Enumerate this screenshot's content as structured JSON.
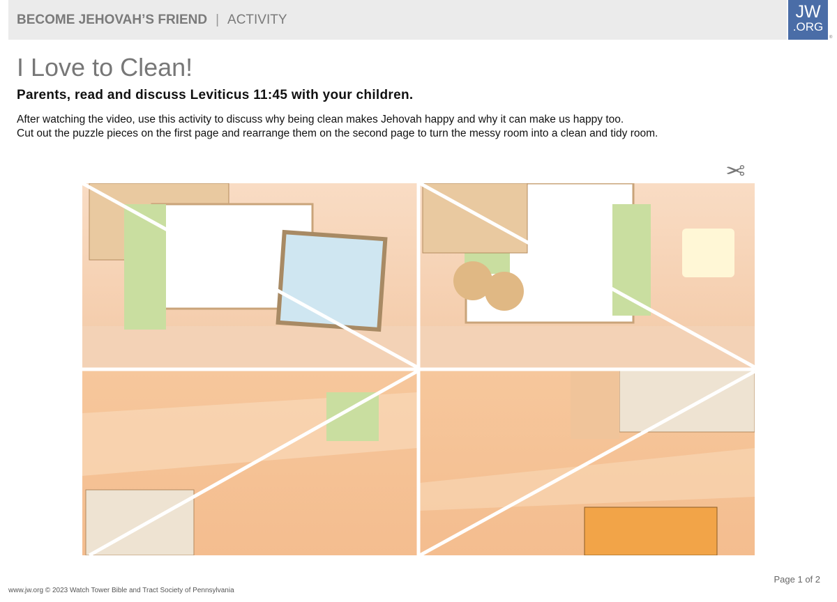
{
  "header": {
    "series": "BECOME JEHOVAH’S FRIEND",
    "section": "ACTIVITY",
    "separator": "|"
  },
  "logo": {
    "line1": "JW",
    "line2": ".ORG",
    "registered": "®"
  },
  "title": "I Love to Clean!",
  "subtitle": "Parents, read and discuss Leviticus 11:45 with your children.",
  "intro": [
    "After watching the video, use this activity to discuss why being clean makes Jehovah happy and why it can make us happy too.",
    "Cut out the puzzle pieces on the first page and rearrange them on the second page to turn the messy room into a clean and tidy room."
  ],
  "scissors_icon": "scissors-icon",
  "footer": {
    "copyright": "www.jw.org © 2023 Watch Tower Bible and Tract Society of Pennsylvania",
    "page": "Page 1 of 2"
  }
}
